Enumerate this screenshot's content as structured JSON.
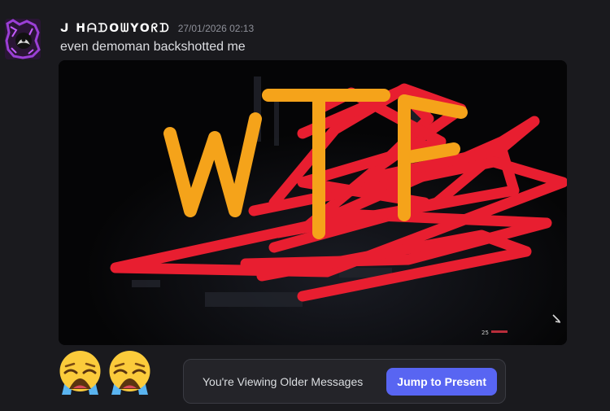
{
  "message": {
    "username": "ᒍ ᕼᗩᗪOᗯYOᖇᗪ",
    "timestamp": "27/01/2026 02:13",
    "text": "even demoman backshotted me"
  },
  "attachment": {
    "scribble_text": "WTF",
    "hud_value": "25"
  },
  "reactions": [
    {
      "icon": "loudly-crying-face-icon"
    },
    {
      "icon": "loudly-crying-face-icon"
    }
  ],
  "older_messages_bar": {
    "text": "You're Viewing Older Messages",
    "button_label": "Jump to Present"
  },
  "colors": {
    "background": "#1a1a1e",
    "accent": "#5865f2",
    "scribble_red": "#e81e30",
    "scribble_orange": "#f5a31a"
  }
}
